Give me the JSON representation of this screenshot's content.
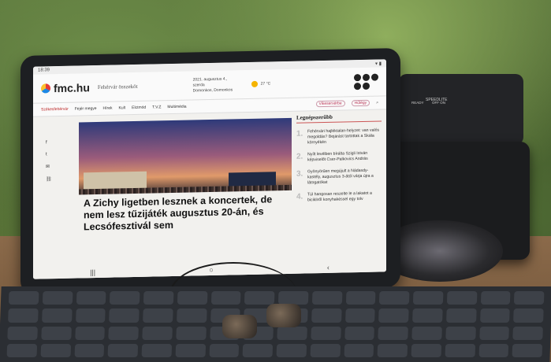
{
  "status_bar": {
    "time": "18:39"
  },
  "site": {
    "logo": "fmc.hu",
    "tagline": "Fehérvár összeköt",
    "date": "2021. augusztus 4., szerda",
    "nameday": "Domonkos, Domonkos",
    "temperature": "27 °C"
  },
  "nav": {
    "items": [
      "Székesfehérvár",
      "Fejér megye",
      "Hírek",
      "Kult",
      "Elctmód",
      "T.V.Z",
      "Multimédia"
    ],
    "pills": [
      "Vikeserxérbe",
      "Hűlégy"
    ]
  },
  "article": {
    "title": "A Zichy ligetben lesznek a koncertek, de nem lesz tűzijáték augusztus 20-án, és Lecsófesztivál sem"
  },
  "sidebar": {
    "heading": "Legnépszerűbb",
    "items": [
      {
        "num": "1.",
        "text": "Fehérvári hajléktalan-helyzet: van valós megoldás? Bejárást tartottak a Skála környékén"
      },
      {
        "num": "2.",
        "text": "Nyílt levélben bírálta Szigli István képviselőt Cser-Palkovics András"
      },
      {
        "num": "3.",
        "text": "Gyönyörűen megújult a Nádasdy-kastély, augusztus 3-ától várja újra a látogatókat"
      },
      {
        "num": "4.",
        "text": "Túl hangosan reszelte le a lakatot a bicikliről konyhakéssel egy tolv"
      }
    ]
  },
  "flash": {
    "brand": "SPEEDLITE",
    "ready": "READY",
    "off_on": "OFF ON"
  }
}
